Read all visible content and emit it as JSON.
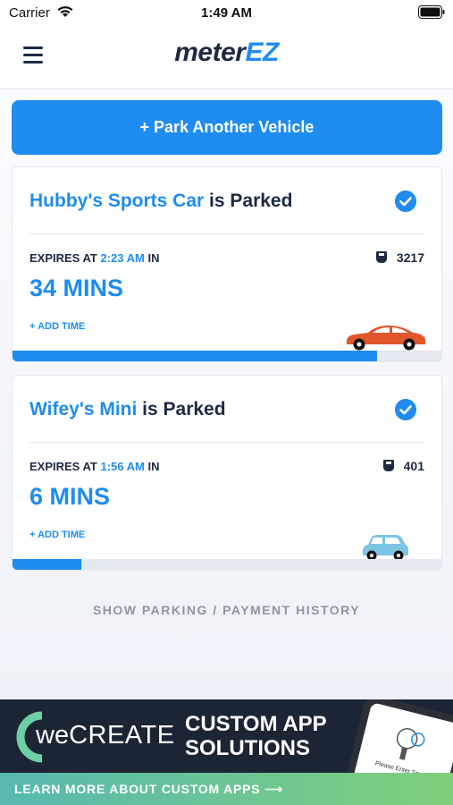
{
  "status_bar": {
    "carrier": "Carrier",
    "time": "1:49 AM"
  },
  "header": {
    "logo_part1": "meter",
    "logo_part2": "EZ"
  },
  "park_button": {
    "label": "+ Park Another Vehicle"
  },
  "vehicles": [
    {
      "name": "Hubby's Sports Car",
      "parked_suffix": " is Parked",
      "expires_prefix": "EXPIRES AT ",
      "expires_time": "2:23 AM",
      "expires_suffix": " IN",
      "space": "3217",
      "remaining": "34 MINS",
      "add_time": "+ ADD TIME",
      "progress": 0.85,
      "car_color": "#e2562b"
    },
    {
      "name": "Wifey's Mini",
      "parked_suffix": " is Parked",
      "expires_prefix": "EXPIRES AT ",
      "expires_time": "1:56 AM",
      "expires_suffix": " IN",
      "space": "401",
      "remaining": "6 MINS",
      "add_time": "+ ADD TIME",
      "progress": 0.16,
      "car_color": "#7cc4e4"
    }
  ],
  "history_link": "SHOW PARKING / PAYMENT HISTORY",
  "ad": {
    "brand_we": "we",
    "brand_create": "CREATE",
    "headline_line1": "CUSTOM APP",
    "headline_line2": "SOLUTIONS",
    "cta": "LEARN MORE ABOUT CUSTOM APPS ⟶",
    "phone_text": "Please Enter Space #"
  },
  "colors": {
    "accent": "#1e8cf0",
    "navy": "#1c2a44"
  }
}
